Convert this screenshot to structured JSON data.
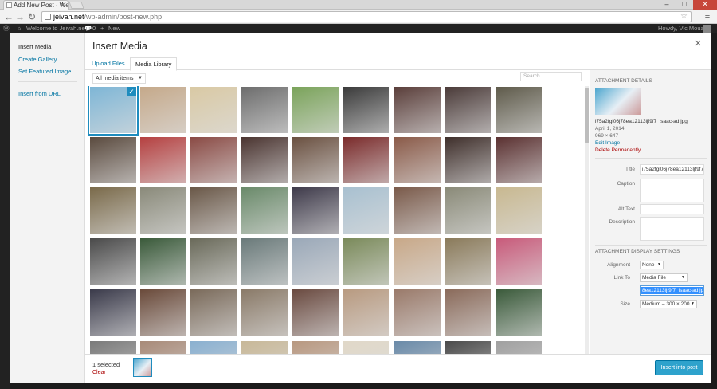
{
  "browser": {
    "tab_title": "Add New Post · Welcome",
    "url_host": "jeivah.net",
    "url_path": "/wp-admin/post-new.php"
  },
  "adminbar": {
    "site": "Welcome to Jeivah.net!",
    "comments": "0",
    "new": "New",
    "howdy": "Howdy, Vic Moua"
  },
  "menu": {
    "insert_media": "Insert Media",
    "create_gallery": "Create Gallery",
    "set_featured": "Set Featured Image",
    "insert_url": "Insert from URL"
  },
  "frame": {
    "title": "Insert Media",
    "tabs": [
      "Upload Files",
      "Media Library"
    ],
    "filter": "All media items",
    "search_placeholder": "Search"
  },
  "thumb_colors": [
    [
      "#7eb6d6",
      "#c5a98a",
      "#d9c9a4",
      "#6d6d6d",
      "#7aa35a",
      "#3a3a3a",
      "#5a3e3a",
      "#4a3a38",
      "#5e5a4a"
    ],
    [
      "#5a4a3e",
      "#b54040",
      "#8a4a44",
      "#4a3430",
      "#6a5040",
      "#7a2a2a",
      "#8a5a48",
      "#3e2e2a",
      "#5a3030"
    ],
    [
      "#7a6a4a",
      "#8a8a7a",
      "#6a5848",
      "#6a8a6a",
      "#3e3a4a",
      "#a8c0d0",
      "#7a5a4a",
      "#8a8a78",
      "#c8b890"
    ],
    [
      "#4a4a4a",
      "#3a5a3a",
      "#6a6a5a",
      "#6a7a7a",
      "#9aa8b8",
      "#7a8a5a",
      "#c8a888",
      "#8a7a5a",
      "#c85a7a"
    ],
    [
      "#3a3a4a",
      "#6a4a3a",
      "#7a6a5a",
      "#8a7a68",
      "#6a4a40",
      "#b89a80",
      "#9a7a6a",
      "#8a6a5a",
      "#3a5a3a"
    ],
    [
      "#7a7a7a",
      "#a88a78",
      "#8ab0d0",
      "#c8b898",
      "#b89880",
      "#e0d8c8",
      "#6a8aa8",
      "#4a4a4a",
      "#a0a0a0"
    ]
  ],
  "details": {
    "header": "ATTACHMENT DETAILS",
    "filename": "i75a2fgl06j78ea12113ljf9f7_lsaac-ad.jpg",
    "date": "April 1, 2014",
    "dimensions": "969 × 647",
    "edit": "Edit Image",
    "delete": "Delete Permanently",
    "title_label": "Title",
    "title_value": "i75a2fgl06j78ea12113ljf9f7_",
    "caption_label": "Caption",
    "alt_label": "Alt Text",
    "description_label": "Description",
    "display_header": "ATTACHMENT DISPLAY SETTINGS",
    "alignment_label": "Alignment",
    "alignment_value": "None",
    "link_label": "Link To",
    "link_value": "Media File",
    "url_value": "8ea12113ljf9f7_lsaac-ad.jpg",
    "size_label": "Size",
    "size_value": "Medium – 300 × 200"
  },
  "footer": {
    "selected": "1 selected",
    "clear": "Clear",
    "insert_button": "Insert into post"
  }
}
